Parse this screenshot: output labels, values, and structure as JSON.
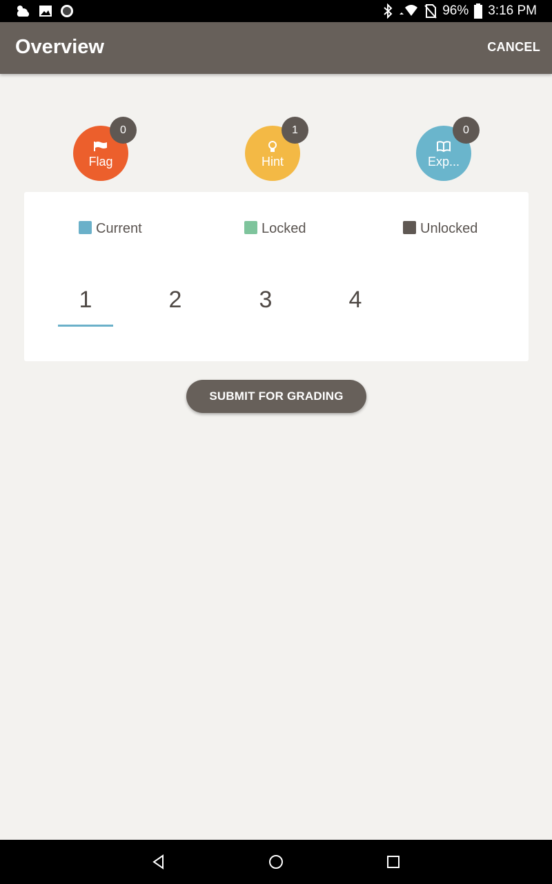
{
  "status_bar": {
    "battery": "96%",
    "time": "3:16 PM"
  },
  "app_bar": {
    "title": "Overview",
    "cancel_label": "CANCEL"
  },
  "stats": [
    {
      "label": "Flag",
      "count": "0",
      "color": "#ec5f2c",
      "icon": "flag-icon"
    },
    {
      "label": "Hint",
      "count": "1",
      "color": "#f3b945",
      "icon": "lightbulb-icon"
    },
    {
      "label": "Exp...",
      "count": "0",
      "color": "#6ab5cc",
      "icon": "book-icon"
    }
  ],
  "legend": [
    {
      "label": "Current",
      "color": "#6ab0c9"
    },
    {
      "label": "Locked",
      "color": "#7ec49c"
    },
    {
      "label": "Unlocked",
      "color": "#5f5853"
    }
  ],
  "questions": [
    "1",
    "2",
    "3",
    "4"
  ],
  "active_question": "1",
  "submit_label": "SUBMIT FOR GRADING"
}
